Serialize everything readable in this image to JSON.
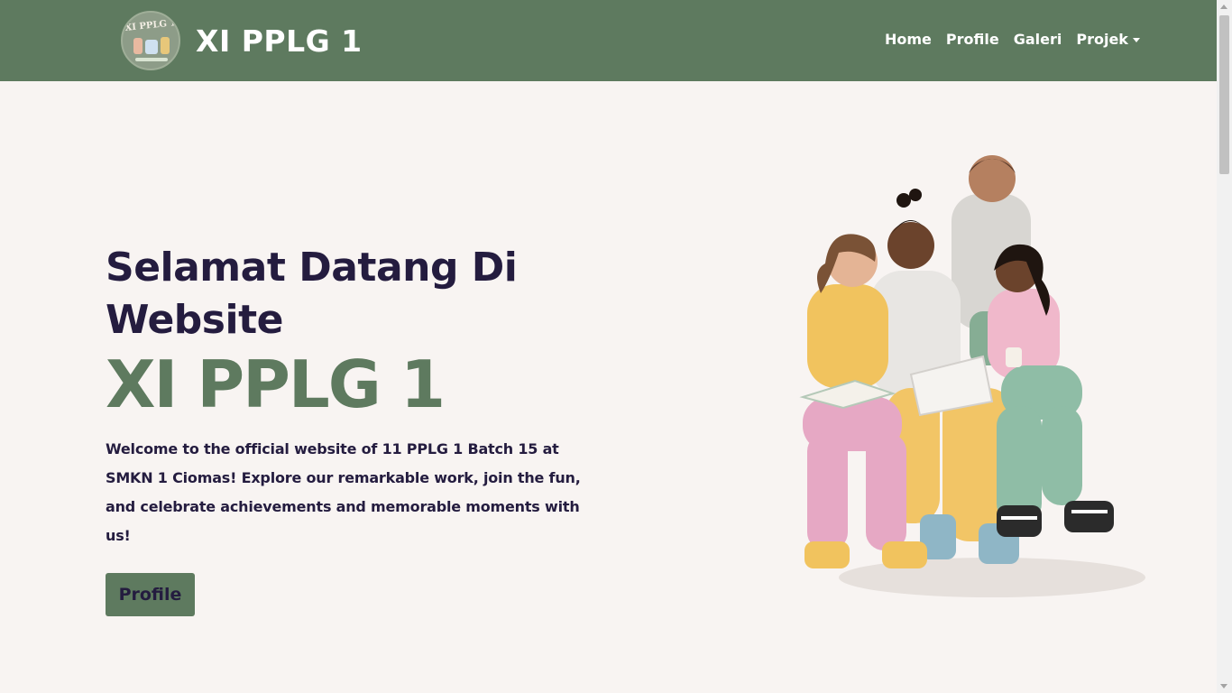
{
  "navbar": {
    "brand_title": "XI PPLG 1",
    "logo_text": "XI PPLG 1",
    "links": [
      "Home",
      "Profile",
      "Galeri"
    ],
    "dropdown_label": "Projek"
  },
  "hero": {
    "heading": "Selamat Datang Di Website",
    "brand": "XI PPLG 1",
    "description": "Welcome to the official website of 11 PPLG 1 Batch 15 at SMKN 1 Ciomas! Explore our remarkable work, join the fun, and celebrate achievements and memorable moments with us!",
    "button_label": "Profile"
  },
  "colors": {
    "primary": "#5e7a5f",
    "heading": "#241c3f",
    "background": "#f8f4f2"
  },
  "icons": [
    "logo-icon",
    "chevron-down-icon",
    "students-illustration"
  ]
}
